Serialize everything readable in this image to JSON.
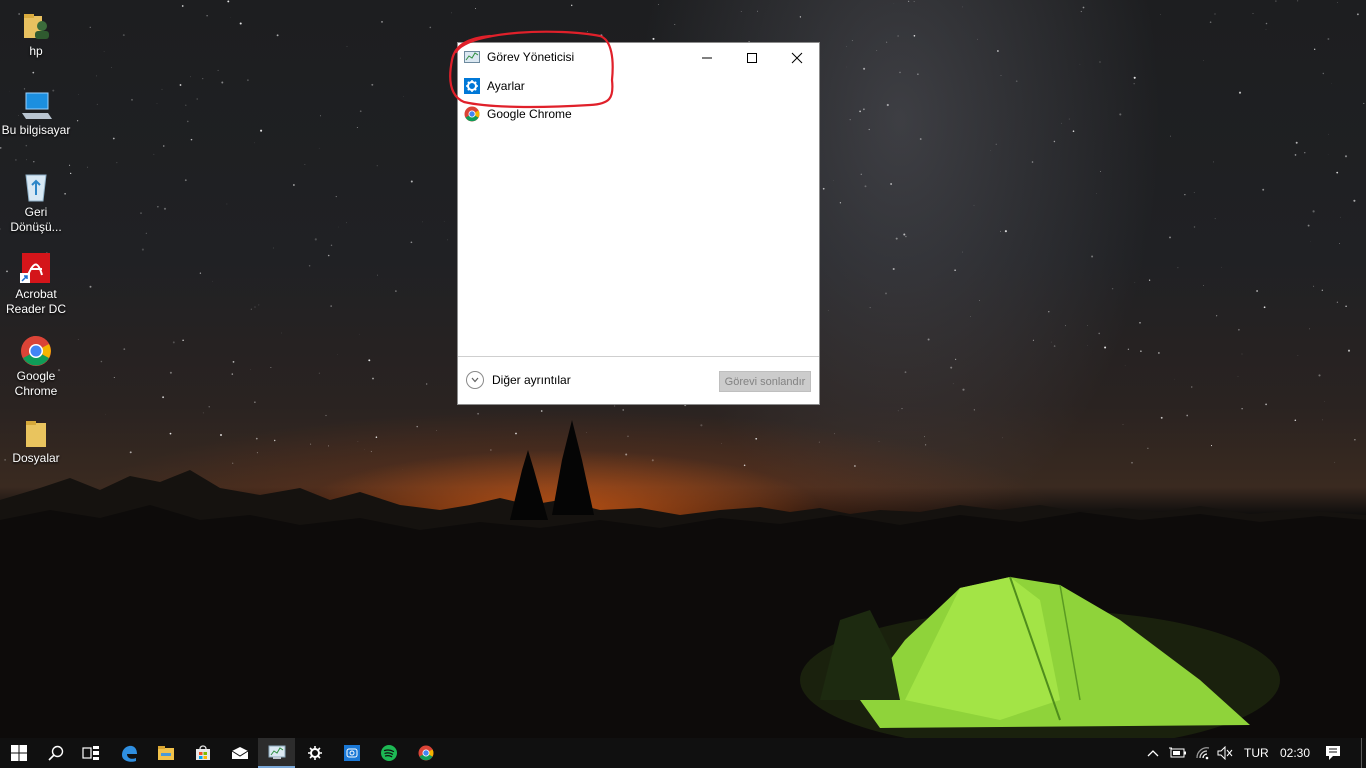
{
  "desktop": {
    "icons": [
      {
        "label": "hp",
        "icon": "user-folder-icon"
      },
      {
        "label": "Bu bilgisayar",
        "icon": "computer-icon"
      },
      {
        "label": "Geri Dönüşü...",
        "icon": "recycle-bin-icon"
      },
      {
        "label": "Acrobat Reader DC",
        "icon": "acrobat-icon"
      },
      {
        "label": "Google Chrome",
        "icon": "chrome-icon"
      },
      {
        "label": "Dosyalar",
        "icon": "folder-icon"
      }
    ]
  },
  "task_manager": {
    "tasks": [
      {
        "label": "Görev Yöneticisi",
        "icon": "task-manager-icon"
      },
      {
        "label": "Ayarlar",
        "icon": "gear-icon"
      },
      {
        "label": "Google Chrome",
        "icon": "chrome-icon"
      }
    ],
    "more_details_label": "Diğer ayrıntılar",
    "end_task_label": "Görevi sonlandır",
    "end_task_enabled": false
  },
  "annotation": {
    "color": "#e0202a",
    "shape": "freehand-circle",
    "target": "first-two-tasks"
  },
  "taskbar": {
    "pinned": [
      {
        "icon": "search-icon"
      },
      {
        "icon": "task-view-icon"
      },
      {
        "icon": "edge-icon"
      },
      {
        "icon": "file-explorer-icon"
      },
      {
        "icon": "store-icon"
      },
      {
        "icon": "mail-icon"
      },
      {
        "icon": "task-manager-icon",
        "active": true
      },
      {
        "icon": "gear-icon"
      },
      {
        "icon": "camera-app-icon"
      },
      {
        "icon": "spotify-icon"
      },
      {
        "icon": "chrome-icon"
      }
    ],
    "tray": {
      "language": "TUR",
      "time": "02:30"
    }
  },
  "colors": {
    "taskbar": "#101010",
    "accent": "#0078d7",
    "tent": "#9adf3c"
  }
}
